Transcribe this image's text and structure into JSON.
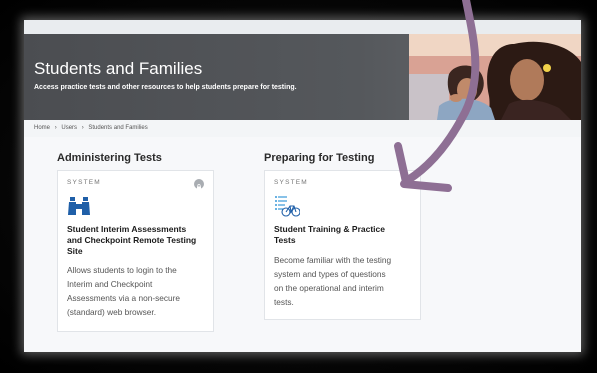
{
  "hero": {
    "title": "Students and Families",
    "subtitle": "Access practice tests and other resources to help students prepare for testing."
  },
  "breadcrumb": {
    "items": [
      "Home",
      "›",
      "Users",
      "›",
      "Students and Families"
    ]
  },
  "sections": [
    {
      "title": "Administering Tests",
      "card": {
        "label": "SYSTEM",
        "title_lines": [
          "Student Interim Assessments",
          "and Checkpoint Remote Testing",
          "Site"
        ],
        "desc_lines": [
          "Allows students to login to the",
          "Interim and Checkpoint",
          "Assessments via a non-secure",
          "(standard) web browser."
        ],
        "icon": "binoculars-icon",
        "badge_icon": "lock-icon"
      }
    },
    {
      "title": "Preparing for Testing",
      "card": {
        "label": "SYSTEM",
        "title_lines": [
          "Student Training & Practice",
          "Tests"
        ],
        "desc_lines": [
          "Become familiar with the testing",
          "system and types of questions",
          "on the operational and interim",
          "tests."
        ],
        "icon": "checklist-bike-icon"
      }
    }
  ],
  "colors": {
    "hero_bg": "#4b4d51",
    "icon_blue": "#1f5fa8",
    "icon_lightblue": "#3a9ad9",
    "arrow": "#8e6f94"
  }
}
